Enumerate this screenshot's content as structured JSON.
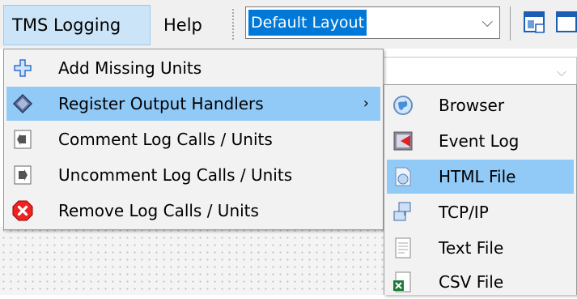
{
  "menubar": {
    "tms_logging": "TMS Logging",
    "help": "Help",
    "layout_combo": "Default Layout",
    "combo_arrow": "⌵"
  },
  "tms_menu": {
    "items": [
      {
        "label": "Add Missing Units",
        "icon": "plus-icon"
      },
      {
        "label": "Register Output Handlers",
        "icon": "diamond-icon",
        "submenu_arrow": "›"
      },
      {
        "label": "Comment Log Calls / Units",
        "icon": "comment-icon"
      },
      {
        "label": "Uncomment Log Calls / Units",
        "icon": "uncomment-icon"
      },
      {
        "label": "Remove Log Calls / Units",
        "icon": "remove-icon"
      }
    ]
  },
  "handlers_menu": {
    "items": [
      {
        "label": "Browser",
        "icon": "globe-icon"
      },
      {
        "label": "Event Log",
        "icon": "event-log-icon"
      },
      {
        "label": "HTML File",
        "icon": "html-file-icon"
      },
      {
        "label": "TCP/IP",
        "icon": "network-icon"
      },
      {
        "label": "Text File",
        "icon": "text-file-icon"
      },
      {
        "label": "CSV File",
        "icon": "csv-file-icon"
      }
    ]
  },
  "colors": {
    "highlight": "#91c9f7",
    "menu_bg": "#f2f2f2",
    "selection": "#0078d7"
  }
}
